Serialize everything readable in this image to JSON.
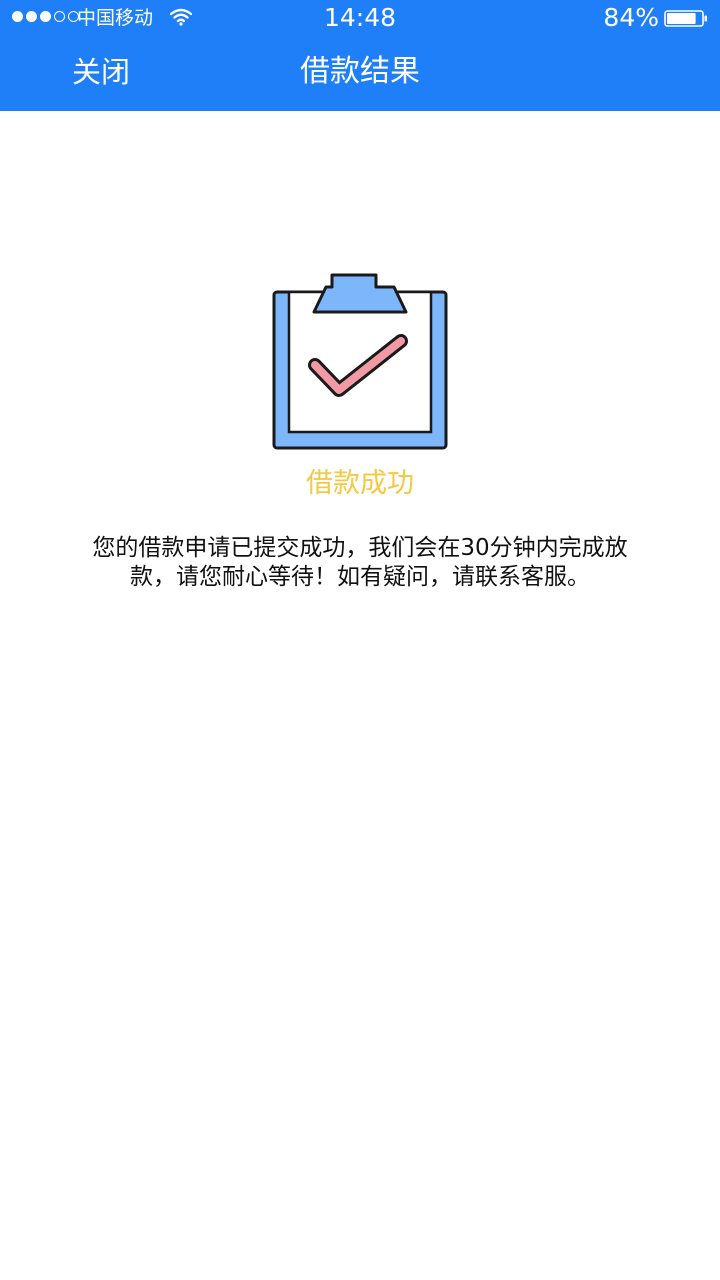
{
  "status_bar": {
    "carrier": "中国移动",
    "time": "14:48",
    "battery": "84%",
    "signal_bars": 3,
    "signal_total": 5,
    "battery_level": 0.84
  },
  "nav": {
    "close_label": "关闭",
    "title": "借款结果"
  },
  "result": {
    "icon": "clipboard-check-icon",
    "title": "借款成功",
    "message": "您的借款申请已提交成功，我们会在30分钟内完成放款，请您耐心等待！如有疑问，请联系客服。"
  },
  "colors": {
    "header_bg": "#1f7ff9",
    "success_title": "#f5c842",
    "clipboard_frame": "#7db6fb",
    "check": "#f29aa3"
  }
}
